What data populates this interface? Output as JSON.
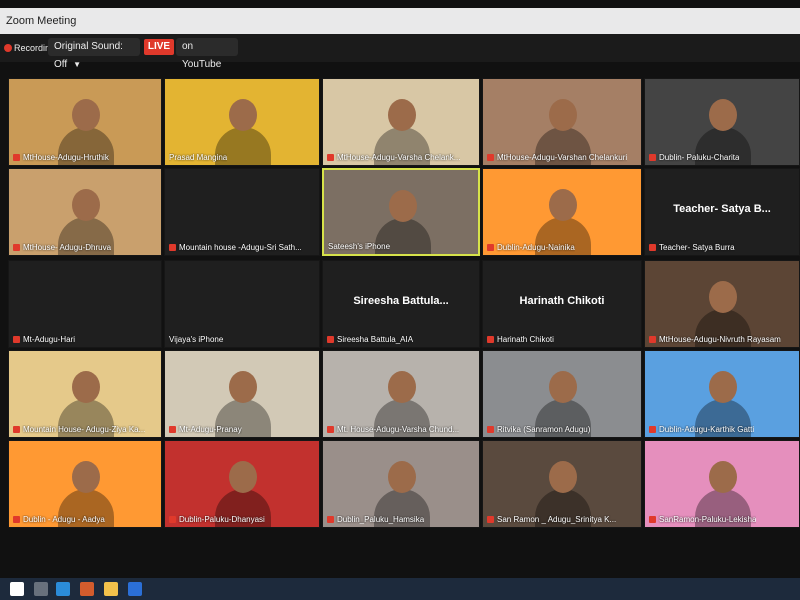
{
  "window": {
    "title": "Zoom Meeting"
  },
  "controls": {
    "recording_label": "Recording",
    "original_sound_label": "Original Sound: Off",
    "live_label": "LIVE",
    "youtube_label": "on YouTube"
  },
  "tiles": [
    {
      "name": "MtHouse-Adugu-Hruthik",
      "muted": true,
      "bg": "#c99a56"
    },
    {
      "name": "Prasad Mangina",
      "muted": false,
      "bg": "#e3b432"
    },
    {
      "name": "MtHouse-Adugu-Varsha Chelank...",
      "muted": true,
      "bg": "#d8c7a5"
    },
    {
      "name": "MtHouse-Adugu-Varshan Chelankuri",
      "muted": true,
      "bg": "#a57f65"
    },
    {
      "name": "Dublin- Paluku-Charita",
      "muted": true,
      "bg": "#444444"
    },
    {
      "name": "MtHouse- Adugu-Dhruva",
      "muted": true,
      "bg": "#c9a06d"
    },
    {
      "name": "Mountain house -Adugu-Sri Sath...",
      "muted": true,
      "bg": "#1f1f1f"
    },
    {
      "name": "Sateesh's iPhone",
      "muted": false,
      "bg": "#7c6f63",
      "active": true
    },
    {
      "name": "Dublin-Adugu-Nainika",
      "muted": true,
      "bg": "#ff9933"
    },
    {
      "name": "Teacher- Satya Burra",
      "muted": true,
      "bg": "#1f1f1f",
      "big_name": "Teacher- Satya B..."
    },
    {
      "name": "Mt-Adugu-Hari",
      "muted": true,
      "bg": "#1f1f1f"
    },
    {
      "name": "Vijaya's iPhone",
      "muted": false,
      "bg": "#1f1f1f"
    },
    {
      "name": "Sireesha Battula_AIA",
      "muted": true,
      "bg": "#1f1f1f",
      "big_name": "Sireesha Battula..."
    },
    {
      "name": "Harinath Chikoti",
      "muted": true,
      "bg": "#1f1f1f",
      "big_name": "Harinath Chikoti"
    },
    {
      "name": "MtHouse-Adugu-Nivruth Rayasam",
      "muted": true,
      "bg": "#5c4535"
    },
    {
      "name": "Mountain House- Adugu-Ziya Ka...",
      "muted": true,
      "bg": "#e5c98a"
    },
    {
      "name": "Mt-Adugu-Pranay",
      "muted": true,
      "bg": "#d2c9b6"
    },
    {
      "name": "Mt. House-Adugu-Varsha Chund...",
      "muted": true,
      "bg": "#b7b2ac"
    },
    {
      "name": "Ritvika (Sanramon Adugu)",
      "muted": true,
      "bg": "#8b8d90"
    },
    {
      "name": "Dublin-Adugu-Karthik Gatti",
      "muted": true,
      "bg": "#5aa0e0"
    },
    {
      "name": "Dublin - Adugu - Aadya",
      "muted": true,
      "bg": "#ff9933"
    },
    {
      "name": "Dublin-Paluku-Dhanyasi",
      "muted": true,
      "bg": "#c2312e"
    },
    {
      "name": "Dublin_Paluku_Hamsika",
      "muted": true,
      "bg": "#9a8f8a"
    },
    {
      "name": "San Ramon _ Adugu_Srinitya K...",
      "muted": true,
      "bg": "#5a4a3e"
    },
    {
      "name": "SanRamon-Paluku-Lekisha",
      "muted": true,
      "bg": "#e58fbd"
    }
  ]
}
